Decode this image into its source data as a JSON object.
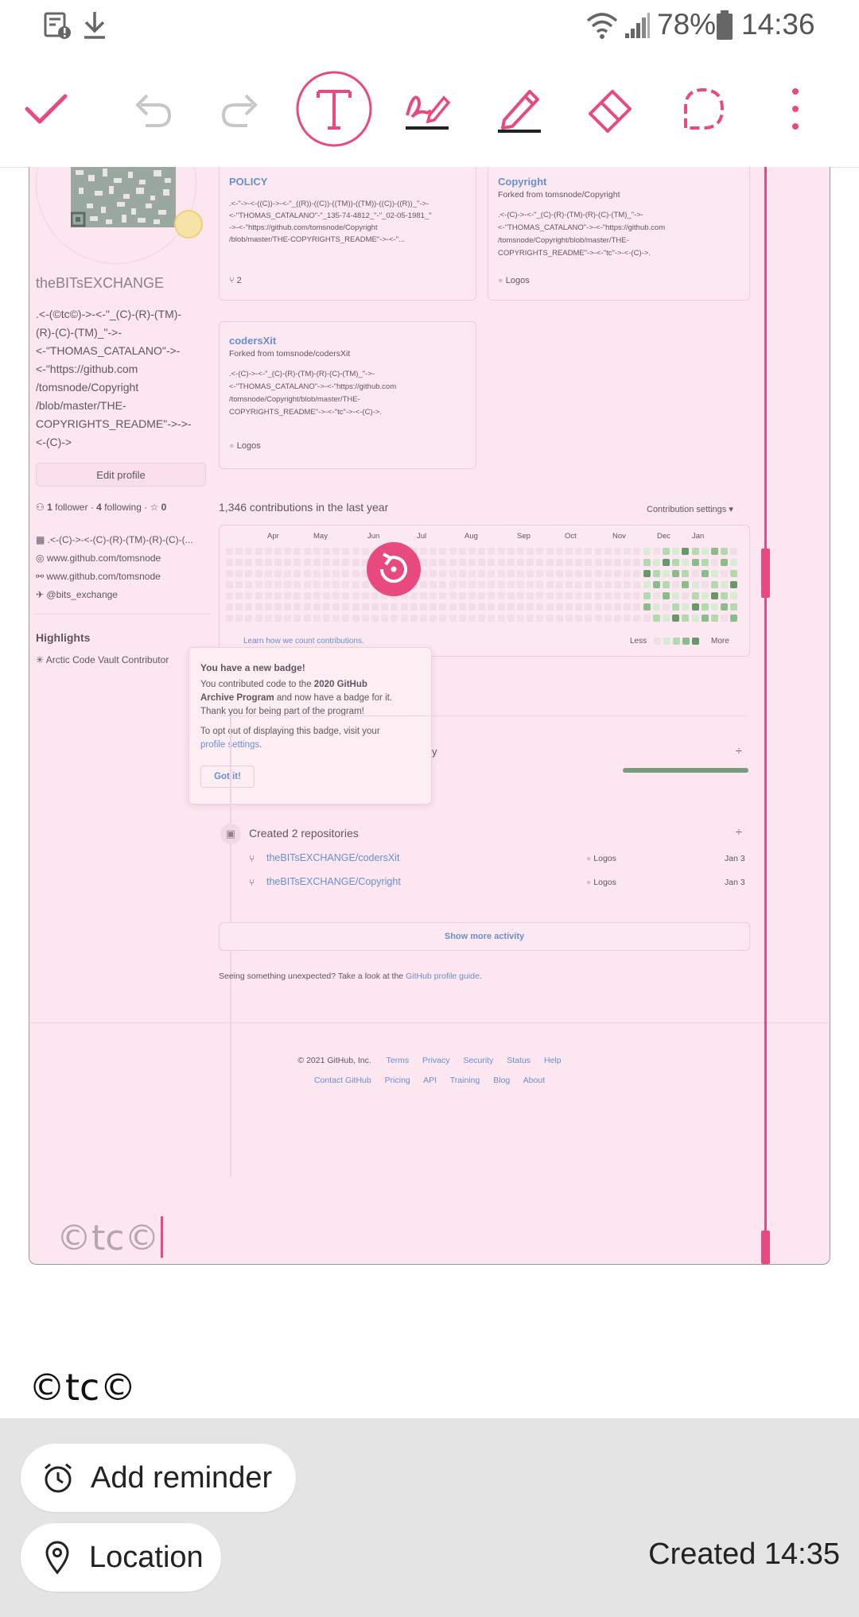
{
  "status_bar": {
    "battery": "78%",
    "time": "14:36"
  },
  "toolbar": {
    "icons": [
      "check-icon",
      "undo-icon",
      "redo-icon",
      "text-tool-icon",
      "handwriting-icon",
      "pen-icon",
      "eraser-icon",
      "lasso-icon",
      "more-icon"
    ]
  },
  "colors": {
    "accent": "#e8497f",
    "canvas_bg": "#fce6ef",
    "bottom_bg": "#e4e4e4"
  },
  "profile": {
    "username": "theBITsEXCHANGE",
    "bio_lines": [
      ".<-(©tc©)->-<-\"_(C)-(R)-(TM)-",
      "(R)-(C)-(TM)_\"->-",
      "<-\"THOMAS_CATALANO\"->-",
      "<-\"https://github.com",
      "/tomsnode/Copyright",
      "/blob/master/THE-",
      "COPYRIGHTS_README\"->->-",
      "<-(C)->"
    ],
    "edit_button": "Edit profile",
    "followers": "1",
    "followers_label": "follower",
    "following": "4",
    "following_label": "following",
    "stars": "0",
    "org": ".<-(C)->-<-(C)-(R)-(TM)-(R)-(C)-(...",
    "website1": "www.github.com/tomsnode",
    "website2": "www.github.com/tomsnode",
    "twitter": "@bits_exchange",
    "highlights_title": "Highlights",
    "highlight_item": "Arctic Code Vault Contributor"
  },
  "repos": [
    {
      "name": "POLICY",
      "desc1": ".<-\"->-<-((C))->-<-\"_((R))-((C))-((TM))-((TM))-((C))-((R))_\"->-",
      "desc2": "<-\"THOMAS_CATALANO\"-\"_135-74-4812_\"-\"_02-05-1981_\"",
      "desc3": "->-<-\"https://github.com/tomsnode/Copyright",
      "desc4": "/blob/master/THE-COPYRIGHTS_README\"->-<-\"...",
      "meta": "2"
    },
    {
      "name": "Copyright",
      "forked": "Forked from tomsnode/Copyright",
      "desc1": ".<-(C)->-<-\"_(C)-(R)-(TM)-(R)-(C)-(TM)_\"->-",
      "desc2": "<-\"THOMAS_CATALANO\"->-<-\"https://github.com",
      "desc3": "/tomsnode/Copyright/blob/master/THE-",
      "desc4": "COPYRIGHTS_README\"->-<-\"tc\"->-<-(C)->.",
      "meta": "Logos"
    },
    {
      "name": "codersXit",
      "forked": "Forked from tomsnode/codersXit",
      "desc1": ".<-(C)->-<-\"_(C)-(R)-(TM)-(R)-(C)-(TM)_\"->-",
      "desc2": "<-\"THOMAS_CATALANO\"->-<-\"https://github.com",
      "desc3": "/tomsnode/Copyright/blob/master/THE-",
      "desc4": "COPYRIGHTS_README\"->-<-\"tc\"->-<-(C)->.",
      "meta": "Logos"
    }
  ],
  "contributions": {
    "title": "1,346 contributions in the last year",
    "settings": "Contribution settings",
    "months": [
      "Apr",
      "May",
      "Jun",
      "Jul",
      "Aug",
      "Sep",
      "Oct",
      "Nov",
      "Dec",
      "Jan"
    ],
    "learn": "Learn how we count contributions.",
    "less": "Less",
    "more": "More"
  },
  "badge_popup": {
    "title": "You have a new badge!",
    "line1a": "You contributed code to the ",
    "line1b": "2020 GitHub",
    "line2a": "Archive Program",
    "line2b": " and now have a badge for it.",
    "line3": "Thank you for being part of the program!",
    "line4": "To opt out of displaying this badge, visit your",
    "line5a": "profile settings",
    "line5b": ".",
    "button": "Got it!"
  },
  "activity": {
    "partial_label": "y",
    "created_label": "Created 2 repositories",
    "items": [
      {
        "repo": "theBITsEXCHANGE/codersXit",
        "lang": "Logos",
        "date": "Jan 3"
      },
      {
        "repo": "theBITsEXCHANGE/Copyright",
        "lang": "Logos",
        "date": "Jan 3"
      }
    ],
    "show_more": "Show more activity",
    "unexpected_a": "Seeing something unexpected? Take a look at the ",
    "unexpected_b": "GitHub profile guide",
    "unexpected_c": "."
  },
  "footer": {
    "copyright": "© 2021 GitHub, Inc.",
    "row1": [
      "Terms",
      "Privacy",
      "Security",
      "Status",
      "Help"
    ],
    "row2": [
      "Contact GitHub",
      "Pricing",
      "API",
      "Training",
      "Blog",
      "About"
    ]
  },
  "note": {
    "canvas_text": "©tc©",
    "body_text": "©tc©"
  },
  "bottom": {
    "reminder": "Add reminder",
    "location": "Location",
    "created": "Created 14:35"
  }
}
